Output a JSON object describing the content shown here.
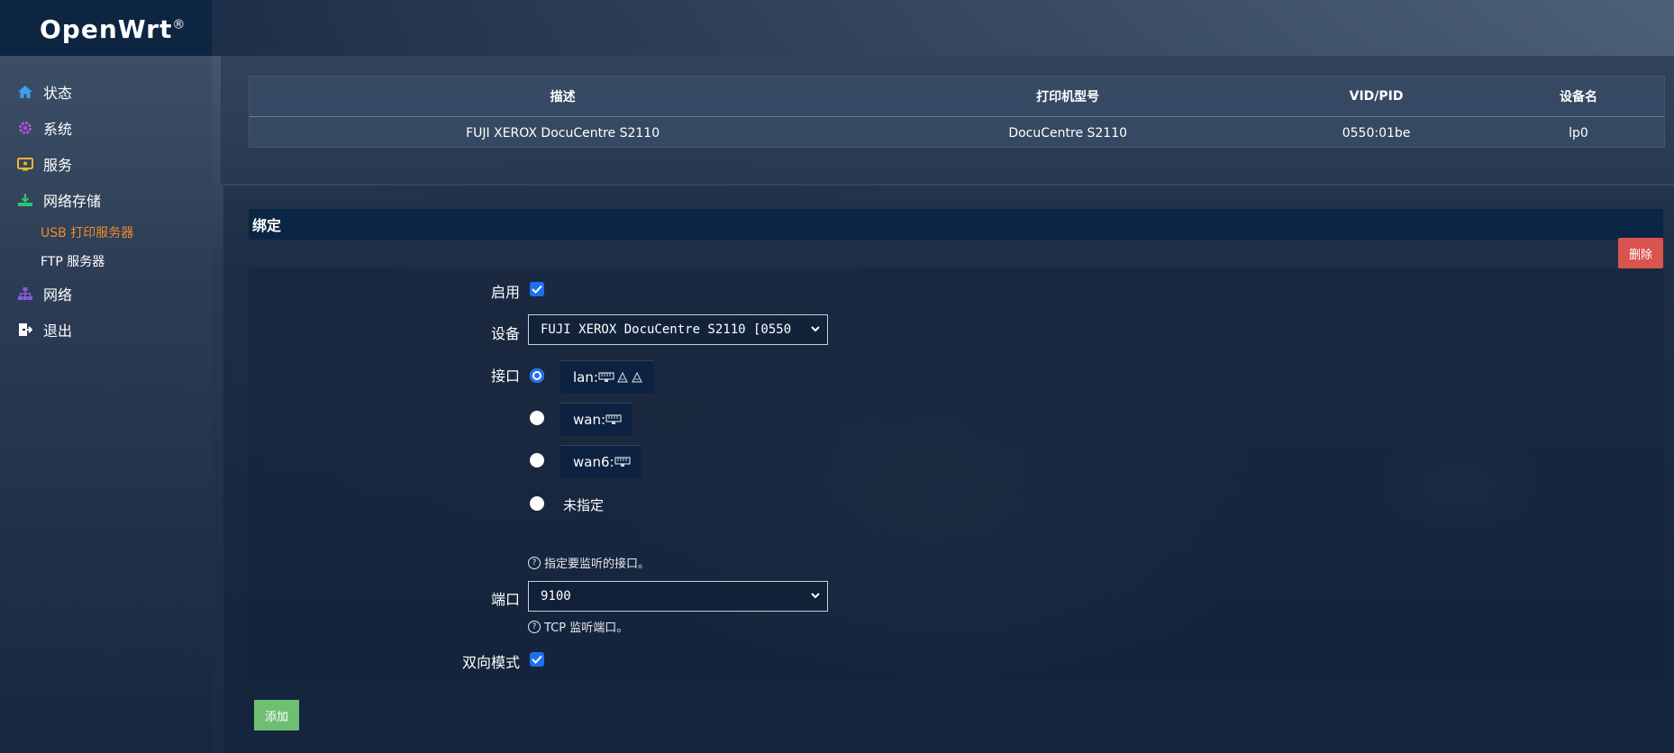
{
  "app": {
    "logo": "OpenWrt",
    "logo_mark": "®"
  },
  "sidebar": {
    "items": [
      {
        "label": "状态",
        "icon": "home-icon"
      },
      {
        "label": "系统",
        "icon": "gear-icon"
      },
      {
        "label": "服务",
        "icon": "services-icon"
      },
      {
        "label": "网络存储",
        "icon": "storage-icon"
      },
      {
        "label": "网络",
        "icon": "network-icon"
      },
      {
        "label": "退出",
        "icon": "logout-icon"
      }
    ],
    "subitems": [
      {
        "label": "USB 打印服务器",
        "active": true
      },
      {
        "label": "FTP 服务器",
        "active": false
      }
    ]
  },
  "printers_table": {
    "headers": [
      "描述",
      "打印机型号",
      "VID/PID",
      "设备名"
    ],
    "rows": [
      [
        "FUJI XEROX DocuCentre S2110",
        "DocuCentre S2110",
        "0550:01be",
        "lp0"
      ]
    ]
  },
  "binding": {
    "section_title": "绑定",
    "delete_label": "删除",
    "enable_label": "启用",
    "enable_checked": true,
    "device_label": "设备",
    "device_value": "FUJI XEROX DocuCentre S2110 [0550",
    "interface_label": "接口",
    "interfaces": [
      {
        "label": "lan:",
        "checked": true
      },
      {
        "label": "wan:",
        "checked": false
      },
      {
        "label": "wan6:",
        "checked": false
      },
      {
        "label": "未指定",
        "checked": false
      }
    ],
    "interface_help": "指定要监听的接口。",
    "port_label": "端口",
    "port_value": "9100",
    "port_help": "TCP 监听端口。",
    "bidirectional_label": "双向模式",
    "bidirectional_checked": true,
    "add_label": "添加"
  },
  "colors": {
    "accent_blue": "#1d6ff2",
    "active_orange": "#f08a2c",
    "delete_red": "#d9534f",
    "add_green": "#6fbf73"
  }
}
